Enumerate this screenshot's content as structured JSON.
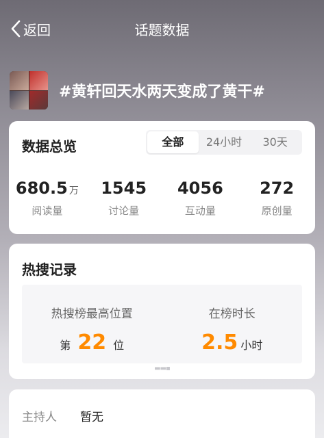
{
  "nav": {
    "back_label": "返回",
    "title": "话题数据"
  },
  "topic": {
    "title": "#黄轩回天水两天变成了黄干#"
  },
  "overview": {
    "title": "数据总览",
    "tabs": [
      {
        "label": "全部"
      },
      {
        "label": "24小时"
      },
      {
        "label": "30天"
      }
    ],
    "active_tab": "全部",
    "stats": [
      {
        "value": "680.5",
        "unit": "万",
        "label": "阅读量"
      },
      {
        "value": "1545",
        "unit": "",
        "label": "讨论量"
      },
      {
        "value": "4056",
        "unit": "",
        "label": "互动量"
      },
      {
        "value": "272",
        "unit": "",
        "label": "原创量"
      }
    ]
  },
  "hot_search": {
    "title": "热搜记录",
    "highest_rank": {
      "label": "热搜榜最高位置",
      "prefix": "第",
      "value": "22",
      "suffix": "位"
    },
    "duration": {
      "label": "在榜时长",
      "value": "2.5",
      "suffix": "小时"
    },
    "accent_color": "#ff8a00"
  },
  "host": {
    "label": "主持人",
    "value": "暂无"
  }
}
